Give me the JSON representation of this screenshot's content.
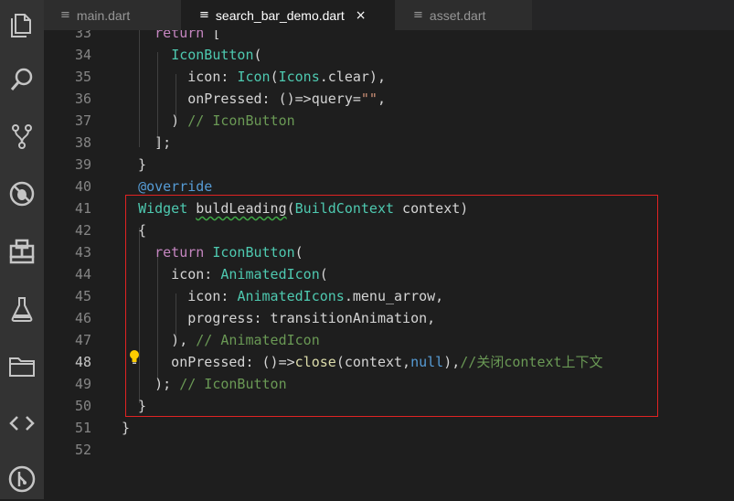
{
  "activity_bar": [
    {
      "name": "explorer-icon"
    },
    {
      "name": "search-icon"
    },
    {
      "name": "source-control-icon"
    },
    {
      "name": "debug-icon"
    },
    {
      "name": "extensions-icon"
    },
    {
      "name": "test-flask-icon"
    },
    {
      "name": "folder-icon"
    },
    {
      "name": "code-icon"
    },
    {
      "name": "git-graph-icon"
    }
  ],
  "tabs": [
    {
      "label": "main.dart",
      "active": false
    },
    {
      "label": "search_bar_demo.dart",
      "active": true,
      "close": "×"
    },
    {
      "label": "asset.dart",
      "active": false
    }
  ],
  "tab_icon": "≡",
  "editor": {
    "current_line": "48",
    "lines": [
      {
        "num": "33",
        "tokens": [
          {
            "t": "    "
          },
          {
            "k": "return"
          },
          {
            "t": " ["
          }
        ]
      },
      {
        "num": "34",
        "tokens": [
          {
            "t": "      "
          },
          {
            "c": "IconButton"
          },
          {
            "t": "("
          }
        ]
      },
      {
        "num": "35",
        "tokens": [
          {
            "t": "        icon: "
          },
          {
            "c": "Icon"
          },
          {
            "t": "("
          },
          {
            "c": "Icons"
          },
          {
            "t": ".clear),"
          }
        ]
      },
      {
        "num": "36",
        "tokens": [
          {
            "t": "        onPressed: ()=>query="
          },
          {
            "s": "\"\""
          },
          {
            "t": ","
          }
        ]
      },
      {
        "num": "37",
        "tokens": [
          {
            "t": "      ) "
          },
          {
            "cm": "// IconButton"
          }
        ]
      },
      {
        "num": "38",
        "tokens": [
          {
            "t": "    ];"
          }
        ]
      },
      {
        "num": "39",
        "tokens": [
          {
            "t": "  }"
          }
        ]
      },
      {
        "num": "40",
        "tokens": [
          {
            "t": "  "
          },
          {
            "b": "@override"
          }
        ]
      },
      {
        "num": "41",
        "tokens": [
          {
            "t": "  "
          },
          {
            "c": "Widget"
          },
          {
            "t": " "
          },
          {
            "sq": "buldLeading"
          },
          {
            "t": "("
          },
          {
            "c": "BuildContext"
          },
          {
            "t": " context)"
          }
        ]
      },
      {
        "num": "42",
        "tokens": [
          {
            "t": "  {"
          }
        ]
      },
      {
        "num": "43",
        "tokens": [
          {
            "t": "    "
          },
          {
            "k": "return"
          },
          {
            "t": " "
          },
          {
            "c": "IconButton"
          },
          {
            "t": "("
          }
        ]
      },
      {
        "num": "44",
        "tokens": [
          {
            "t": "      icon: "
          },
          {
            "c": "AnimatedIcon"
          },
          {
            "t": "("
          }
        ]
      },
      {
        "num": "45",
        "tokens": [
          {
            "t": "        icon: "
          },
          {
            "c": "AnimatedIcons"
          },
          {
            "t": ".menu_arrow,"
          }
        ]
      },
      {
        "num": "46",
        "tokens": [
          {
            "t": "        progress: transitionAnimation,"
          }
        ]
      },
      {
        "num": "47",
        "tokens": [
          {
            "t": "      ), "
          },
          {
            "cm": "// AnimatedIcon"
          }
        ]
      },
      {
        "num": "48",
        "tokens": [
          {
            "t": "      onPressed: ()=>"
          },
          {
            "f": "close"
          },
          {
            "t": "(context,"
          },
          {
            "b": "null"
          },
          {
            "t": "),"
          },
          {
            "cm": "//关闭context上下文"
          }
        ]
      },
      {
        "num": "49",
        "tokens": [
          {
            "t": "    ); "
          },
          {
            "cm": "// IconButton"
          }
        ]
      },
      {
        "num": "50",
        "tokens": [
          {
            "t": "  }"
          }
        ]
      },
      {
        "num": "51",
        "tokens": [
          {
            "t": "}"
          }
        ]
      },
      {
        "num": "52",
        "tokens": [
          {
            "t": ""
          }
        ]
      }
    ]
  },
  "colors": {
    "highlight_box": "#e02323",
    "background": "#1e1e1e",
    "activity_bar": "#333333",
    "lightbulb": "#ffcc00"
  }
}
